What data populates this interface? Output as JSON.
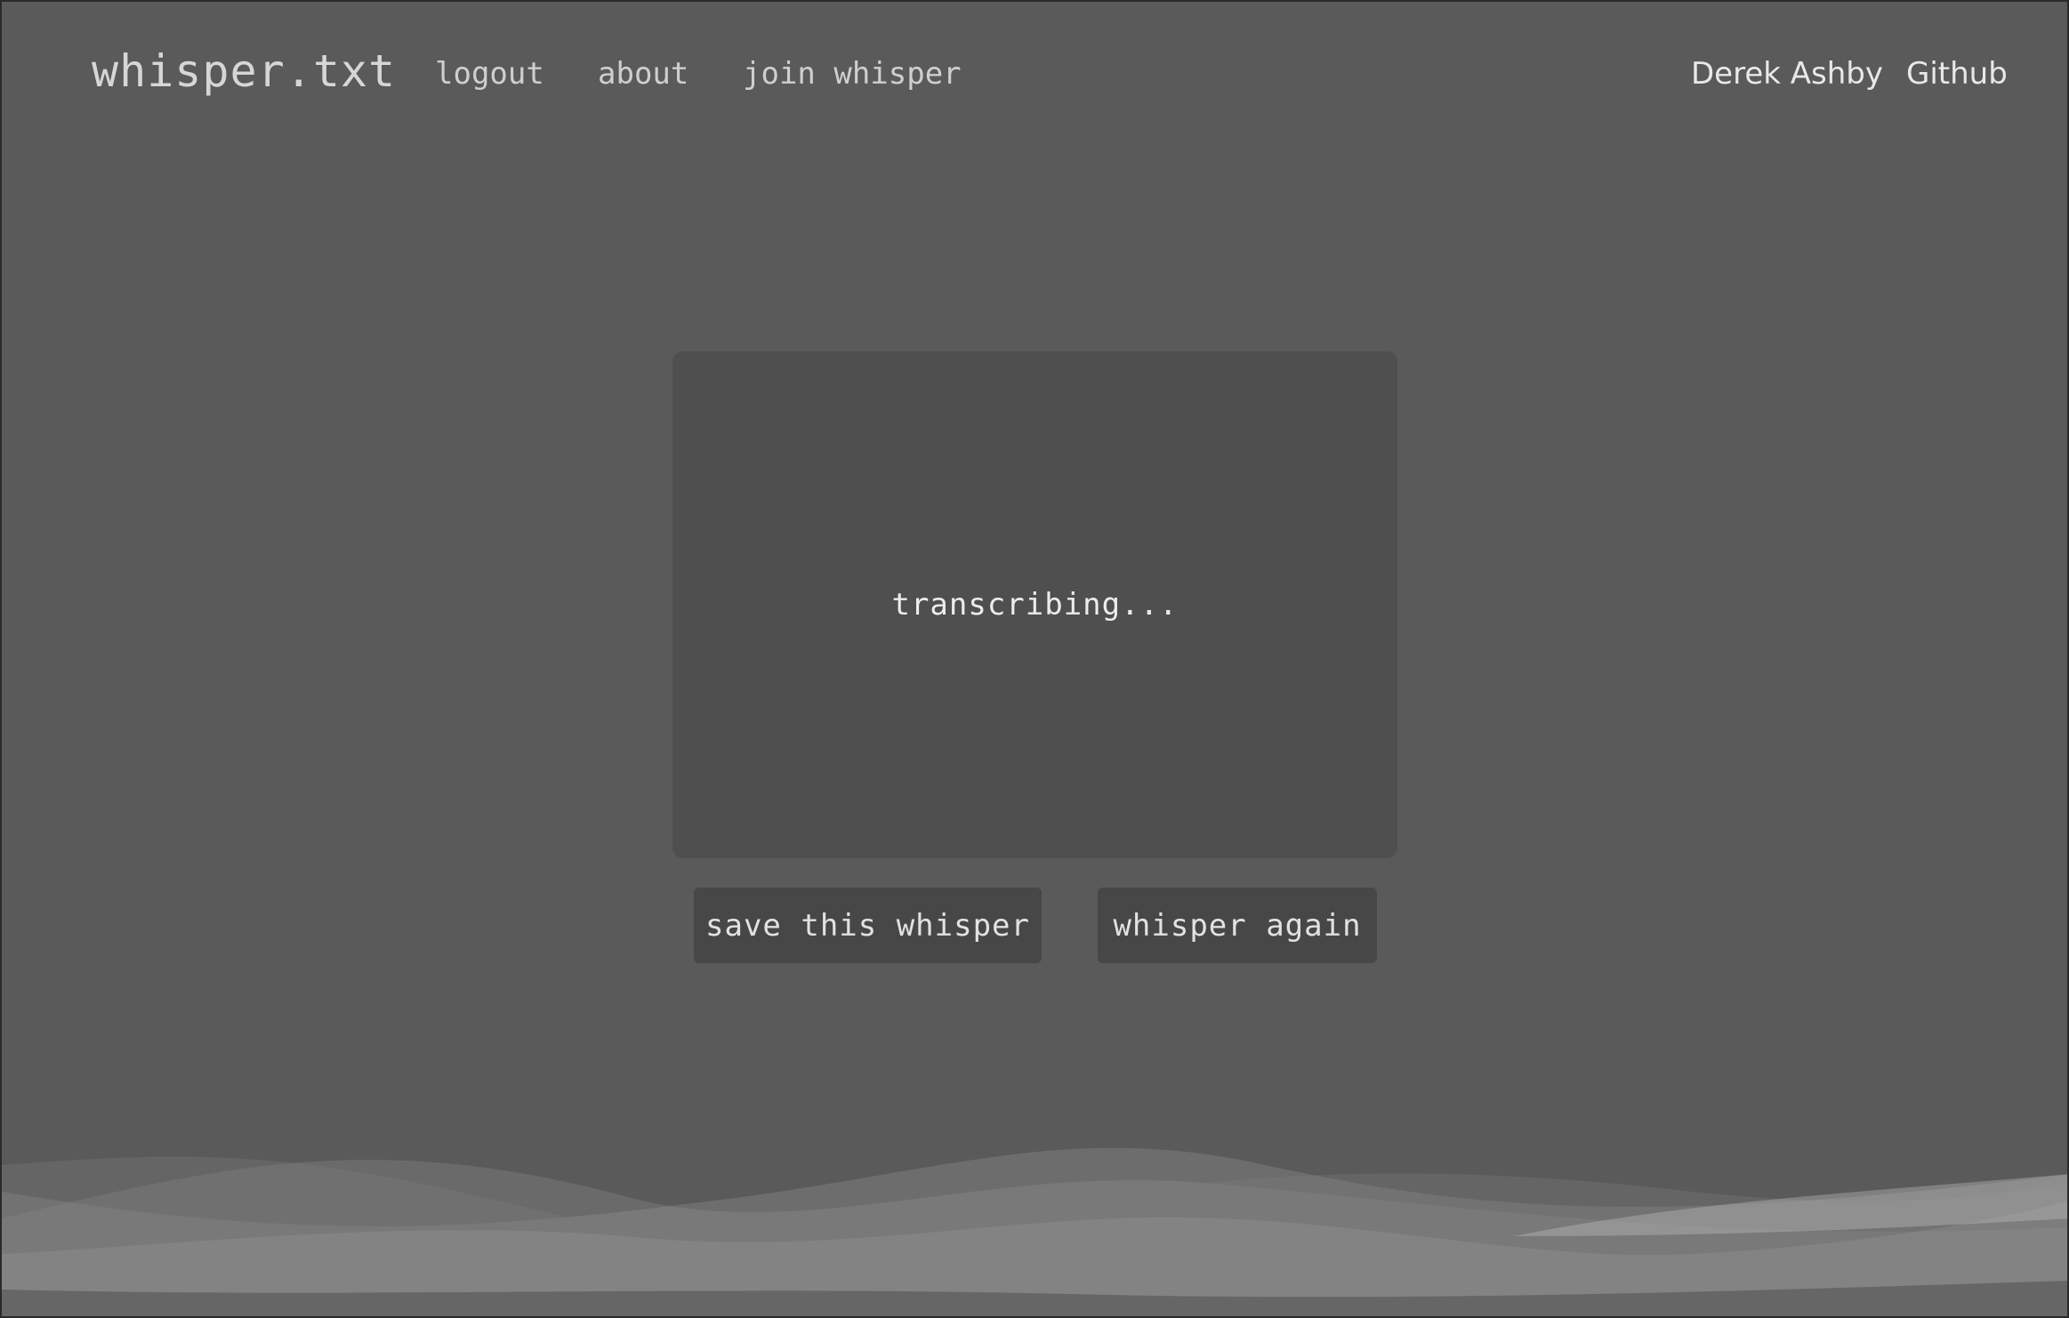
{
  "header": {
    "brand": "whisper.txt",
    "links": {
      "logout": "logout",
      "about": "about",
      "join": "join whisper"
    },
    "right_links": {
      "author": "Derek Ashby",
      "github": "Github"
    }
  },
  "main": {
    "status_text": "transcribing...",
    "buttons": {
      "save": "save this whisper",
      "again": "whisper again"
    }
  },
  "colors": {
    "background": "#5a5a5a",
    "panel": "#4f4f4f",
    "button": "#474747",
    "text": "#e2e2e2"
  },
  "decor": {
    "footer_graphic": "wave-decoration"
  }
}
